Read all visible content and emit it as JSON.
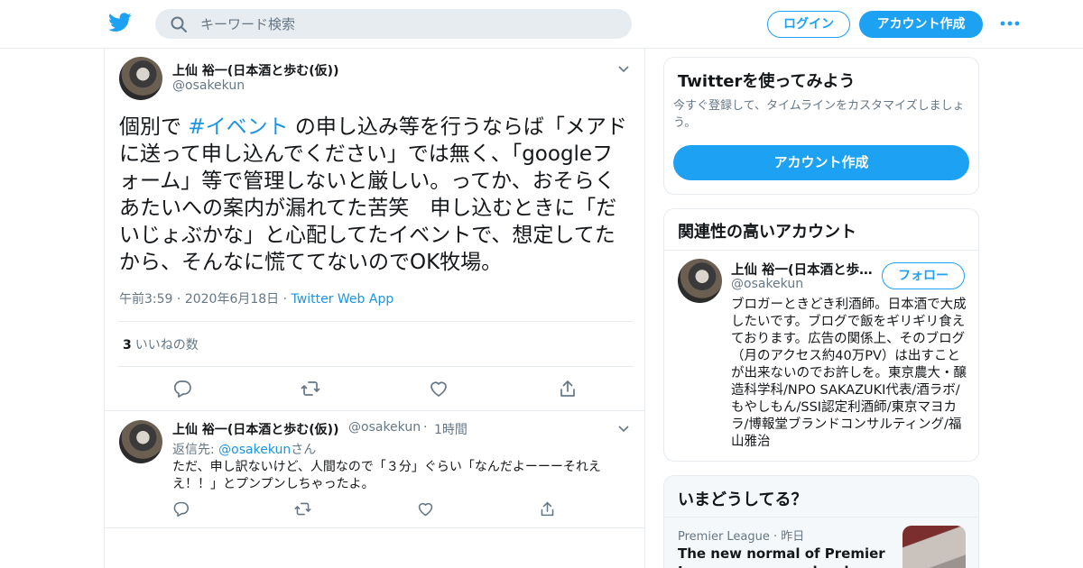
{
  "header": {
    "search_placeholder": "キーワード検索",
    "login_label": "ログイン",
    "signup_label": "アカウント作成",
    "colors": {
      "brand": "#1da1f2",
      "link": "#1b95e0"
    }
  },
  "main_tweet": {
    "author_name": "上仙 裕一(日本酒と歩む(仮))",
    "author_handle": "@osakekun",
    "text_before": "個別で ",
    "hashtag": "#イベント",
    "text_after": " の申し込み等を行うならば「メアドに送って申し込んでください」では無く、「googleフォーム」等で管理しないと厳しい。ってか、おそらくあたいへの案内が漏れてた苦笑　申し込むときに「だいじょぶかな」と心配してたイベントで、想定してたから、そんなに慌ててないのでOK牧場。",
    "time": "午前3:59",
    "date": "2020年6月18日",
    "app": "Twitter Web App",
    "likes_count": "3",
    "likes_label": "いいねの数"
  },
  "reply": {
    "author_name": "上仙 裕一(日本酒と歩む(仮))",
    "author_handle": "@osakekun",
    "ago": "1時間",
    "replying_label": "返信先:",
    "replying_handle": "@osakekun",
    "replying_suffix": "さん",
    "text": "ただ、申し訳ないけど、人間なので「３分」ぐらい「なんだよーーーそれええ！！」とプンプンしちゃったよ。"
  },
  "sidebar": {
    "try_title": "Twitterを使ってみよう",
    "try_sub": "今すぐ登録して、タイムラインをカスタマイズしましょう。",
    "try_button": "アカウント作成",
    "related_title": "関連性の高いアカウント",
    "related_name": "上仙 裕一(日本酒と歩…",
    "related_handle": "@osakekun",
    "follow_label": "フォロー",
    "related_bio": "ブロガーときどき利酒師。日本酒で大成したいです。ブログで飯をギリギリ食えております。広告の関係上、そのブログ（月のアクセス約40万PV）は出すことが出来ないのでお許しを。東京農大・醸造科学科/NPO SAKAZUKI代表/酒ラボ/もやしもん/SSI認定利酒師/東京マヨカラ/博報堂ブランドコンサルティング/福山雅治",
    "trends_title": "いまどうしてる？",
    "trend_source": "Premier League",
    "trend_when": "昨日",
    "trend_headline": "The new normal of Premier League coverage has begun"
  }
}
